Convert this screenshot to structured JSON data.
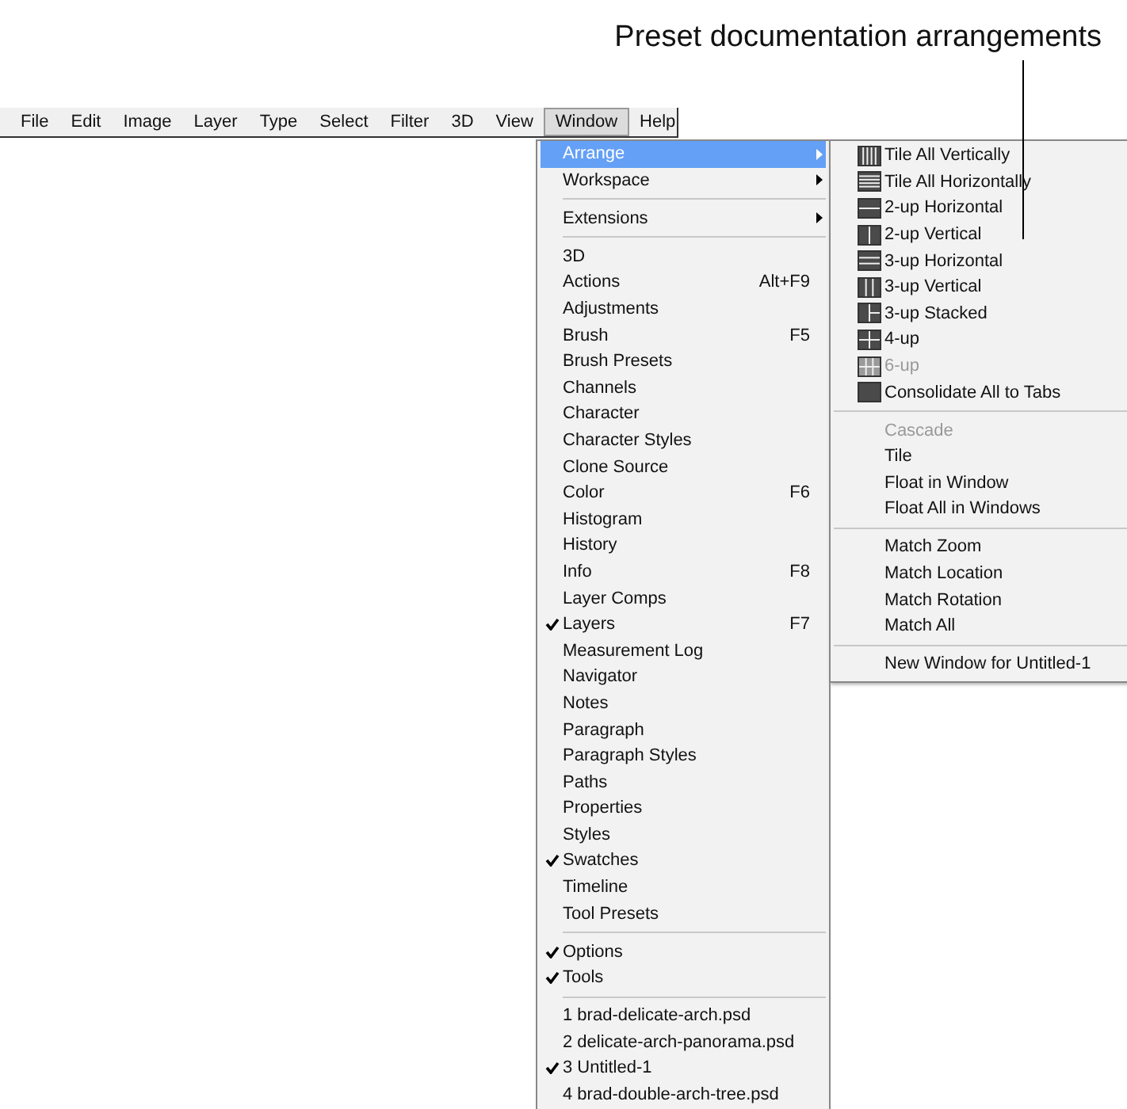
{
  "callout": {
    "text": "Preset documentation arrangements"
  },
  "menubar": [
    {
      "label": "File",
      "selected": false
    },
    {
      "label": "Edit",
      "selected": false
    },
    {
      "label": "Image",
      "selected": false
    },
    {
      "label": "Layer",
      "selected": false
    },
    {
      "label": "Type",
      "selected": false
    },
    {
      "label": "Select",
      "selected": false
    },
    {
      "label": "Filter",
      "selected": false
    },
    {
      "label": "3D",
      "selected": false
    },
    {
      "label": "View",
      "selected": false
    },
    {
      "label": "Window",
      "selected": true
    },
    {
      "label": "Help",
      "selected": false
    }
  ],
  "window_menu": {
    "sections": [
      [
        {
          "label": "Arrange",
          "submenu": true,
          "selected": true,
          "checked": false
        },
        {
          "label": "Workspace",
          "submenu": true,
          "selected": false,
          "checked": false
        }
      ],
      [
        {
          "label": "Extensions",
          "submenu": true,
          "selected": false,
          "checked": false
        }
      ],
      [
        {
          "label": "3D",
          "selected": false,
          "checked": false
        },
        {
          "label": "Actions",
          "shortcut": "Alt+F9",
          "selected": false,
          "checked": false
        },
        {
          "label": "Adjustments",
          "selected": false,
          "checked": false
        },
        {
          "label": "Brush",
          "shortcut": "F5",
          "selected": false,
          "checked": false
        },
        {
          "label": "Brush Presets",
          "selected": false,
          "checked": false
        },
        {
          "label": "Channels",
          "selected": false,
          "checked": false
        },
        {
          "label": "Character",
          "selected": false,
          "checked": false
        },
        {
          "label": "Character Styles",
          "selected": false,
          "checked": false
        },
        {
          "label": "Clone Source",
          "selected": false,
          "checked": false
        },
        {
          "label": "Color",
          "shortcut": "F6",
          "selected": false,
          "checked": false
        },
        {
          "label": "Histogram",
          "selected": false,
          "checked": false
        },
        {
          "label": "History",
          "selected": false,
          "checked": false
        },
        {
          "label": "Info",
          "shortcut": "F8",
          "selected": false,
          "checked": false
        },
        {
          "label": "Layer Comps",
          "selected": false,
          "checked": false
        },
        {
          "label": "Layers",
          "shortcut": "F7",
          "selected": false,
          "checked": true
        },
        {
          "label": "Measurement Log",
          "selected": false,
          "checked": false
        },
        {
          "label": "Navigator",
          "selected": false,
          "checked": false
        },
        {
          "label": "Notes",
          "selected": false,
          "checked": false
        },
        {
          "label": "Paragraph",
          "selected": false,
          "checked": false
        },
        {
          "label": "Paragraph Styles",
          "selected": false,
          "checked": false
        },
        {
          "label": "Paths",
          "selected": false,
          "checked": false
        },
        {
          "label": "Properties",
          "selected": false,
          "checked": false
        },
        {
          "label": "Styles",
          "selected": false,
          "checked": false
        },
        {
          "label": "Swatches",
          "selected": false,
          "checked": true
        },
        {
          "label": "Timeline",
          "selected": false,
          "checked": false
        },
        {
          "label": "Tool Presets",
          "selected": false,
          "checked": false
        }
      ],
      [
        {
          "label": "Options",
          "selected": false,
          "checked": true
        },
        {
          "label": "Tools",
          "selected": false,
          "checked": true
        }
      ],
      [
        {
          "label": "1 brad-delicate-arch.psd",
          "selected": false,
          "checked": false
        },
        {
          "label": "2 delicate-arch-panorama.psd",
          "selected": false,
          "checked": false
        },
        {
          "label": "3 Untitled-1",
          "selected": false,
          "checked": true
        },
        {
          "label": "4 brad-double-arch-tree.psd",
          "selected": false,
          "checked": false
        }
      ]
    ]
  },
  "arrange_submenu": {
    "sections": [
      [
        {
          "label": "Tile All Vertically",
          "kind": "cols4",
          "disabled": false
        },
        {
          "label": "Tile All Horizontally",
          "kind": "rows4",
          "disabled": false
        },
        {
          "label": "2-up Horizontal",
          "kind": "rows2",
          "disabled": false
        },
        {
          "label": "2-up Vertical",
          "kind": "cols2",
          "disabled": false
        },
        {
          "label": "3-up Horizontal",
          "kind": "rows3",
          "disabled": false
        },
        {
          "label": "3-up Vertical",
          "kind": "cols3",
          "disabled": false
        },
        {
          "label": "3-up Stacked",
          "kind": "stacked3",
          "disabled": false
        },
        {
          "label": "4-up",
          "kind": "grid4",
          "disabled": false
        },
        {
          "label": "6-up",
          "kind": "grid6",
          "disabled": true
        },
        {
          "label": "Consolidate All to Tabs",
          "kind": "single",
          "disabled": false
        }
      ],
      [
        {
          "label": "Cascade",
          "kind": "plain",
          "disabled": true
        },
        {
          "label": "Tile",
          "kind": "plain",
          "disabled": false
        },
        {
          "label": "Float in Window",
          "kind": "plain",
          "disabled": false
        },
        {
          "label": "Float All in Windows",
          "kind": "plain",
          "disabled": false
        }
      ],
      [
        {
          "label": "Match Zoom",
          "kind": "plain",
          "disabled": false
        },
        {
          "label": "Match Location",
          "kind": "plain",
          "disabled": false
        },
        {
          "label": "Match Rotation",
          "kind": "plain",
          "disabled": false
        },
        {
          "label": "Match All",
          "kind": "plain",
          "disabled": false
        }
      ],
      [
        {
          "label": "New Window for Untitled-1",
          "kind": "plain",
          "disabled": false
        }
      ]
    ]
  }
}
